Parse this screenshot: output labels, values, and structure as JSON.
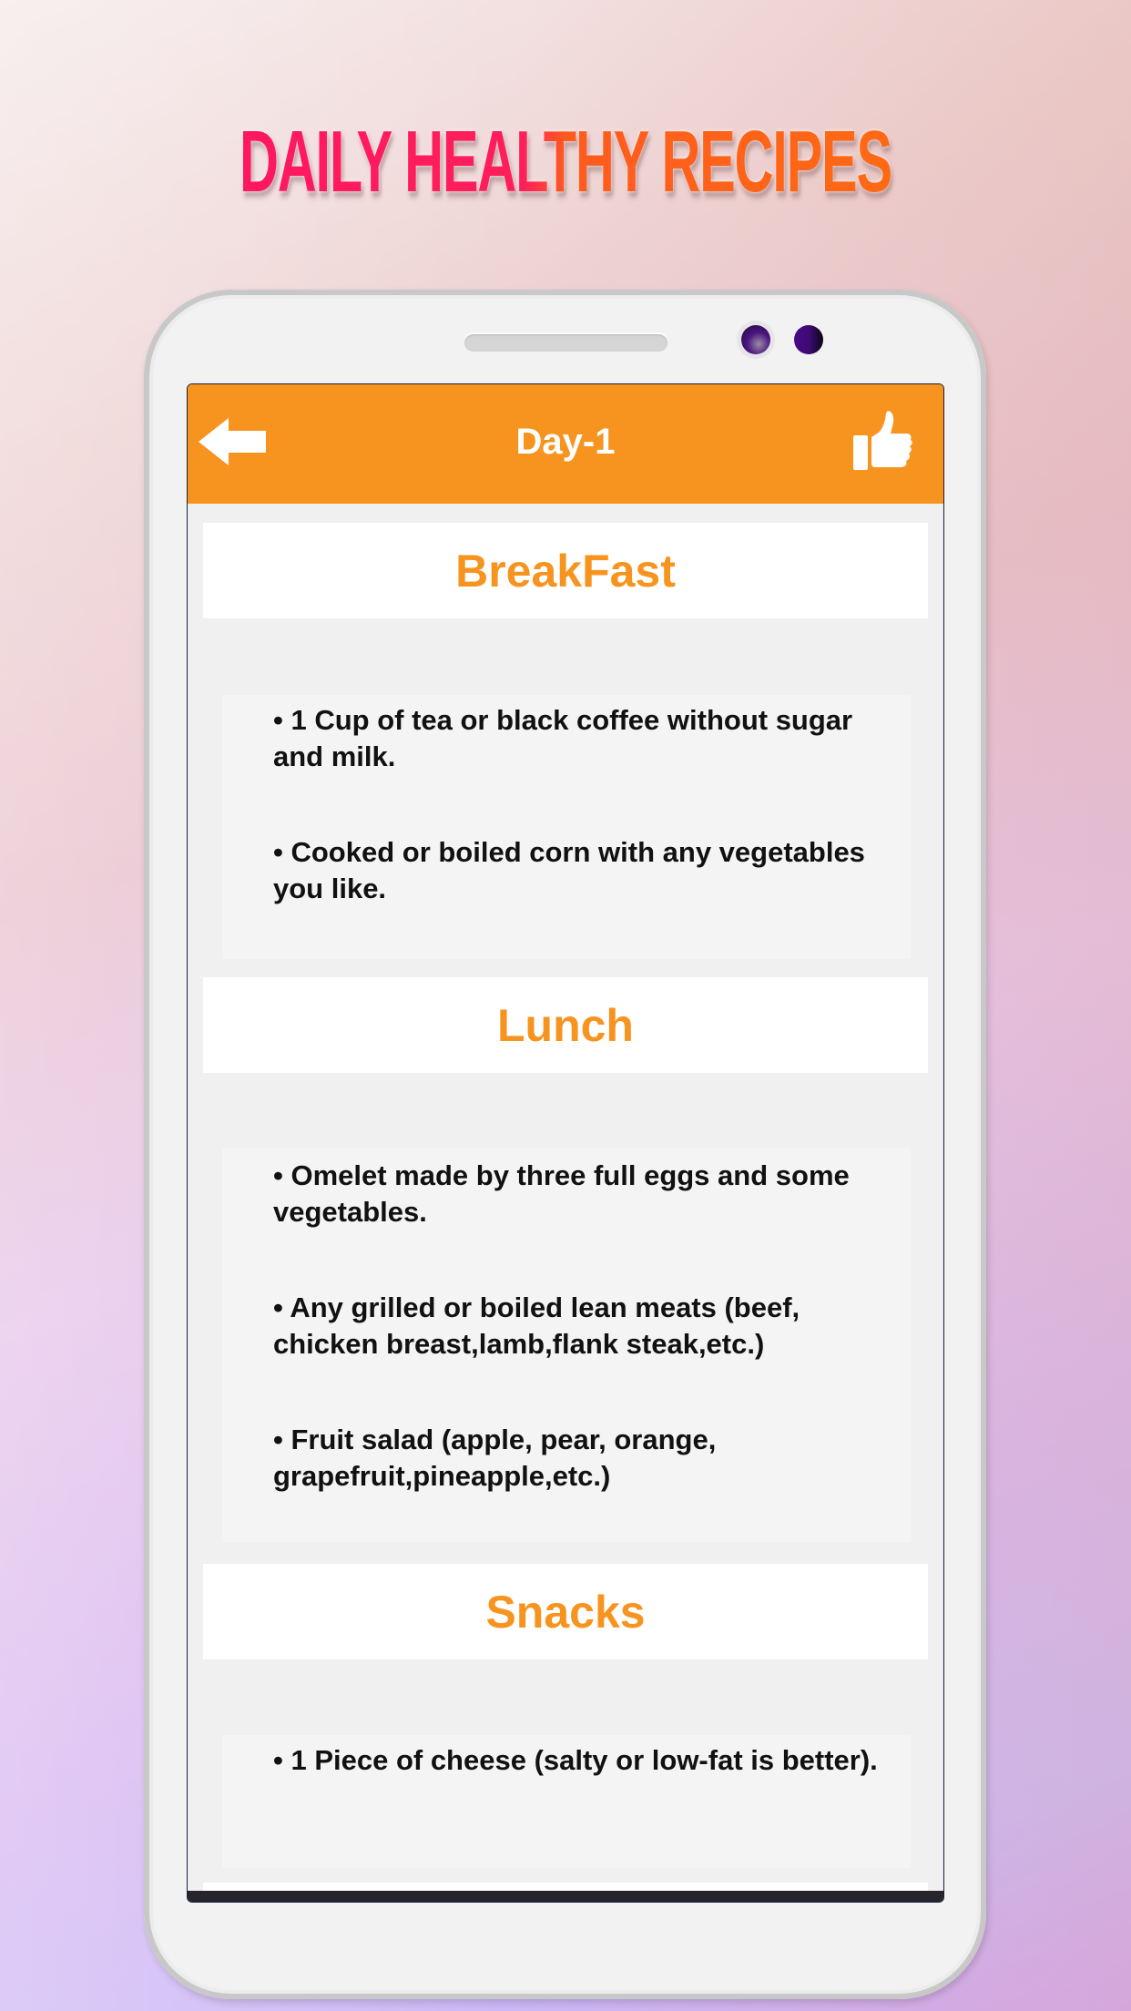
{
  "promo": {
    "headline": "DAILY HEALTHY RECIPES",
    "gradient_colors": [
      "#ff1761",
      "#ff6a12"
    ]
  },
  "app": {
    "header": {
      "title": "Day-1",
      "back_icon": "arrow-left-icon",
      "like_icon": "thumbs-up-icon",
      "background_color": "#f7941f"
    },
    "accent_color": "#f7941f",
    "sections": [
      {
        "title": "BreakFast",
        "items": [
          " • 1 Cup of tea or black coffee without sugar and milk.",
          " • Cooked or boiled corn with any vegetables you like."
        ]
      },
      {
        "title": "Lunch",
        "items": [
          " • Omelet made by three full eggs and some vegetables.",
          " • Any grilled or boiled lean meats (beef, chicken breast,lamb,flank steak,etc.)",
          " • Fruit salad (apple, pear, orange, grapefruit,pineapple,etc.)"
        ]
      },
      {
        "title": "Snacks",
        "items": [
          " • 1 Piece of cheese (salty or low-fat is better)."
        ]
      }
    ]
  }
}
